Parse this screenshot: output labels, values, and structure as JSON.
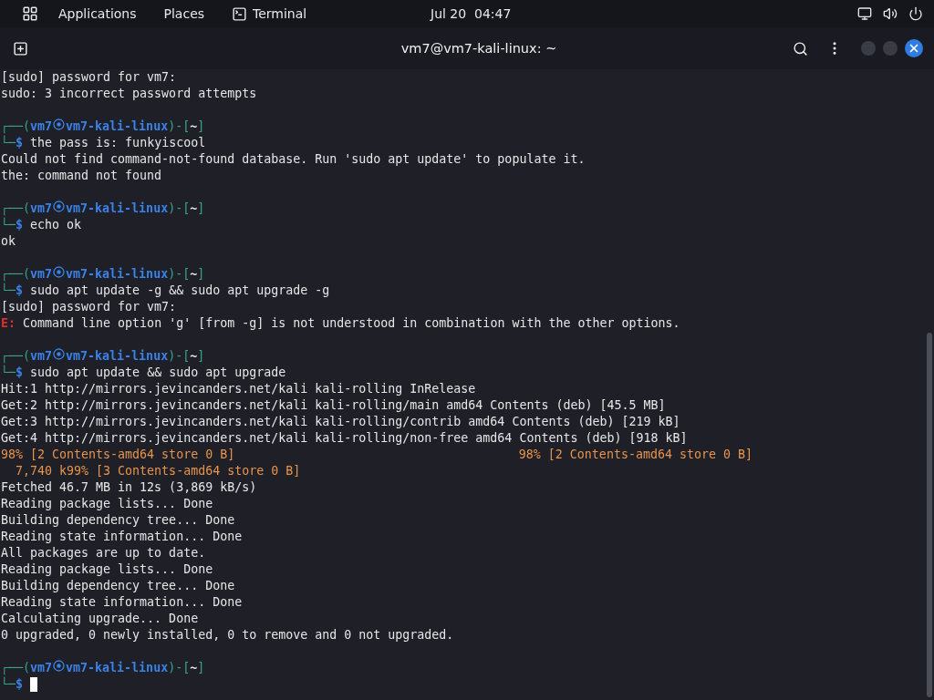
{
  "top_bar": {
    "menus": [
      {
        "label": "Applications",
        "kind": "menu"
      },
      {
        "label": "Places",
        "kind": "menu"
      },
      {
        "label": "Terminal",
        "kind": "app"
      }
    ],
    "clock": "Jul 20  04:47"
  },
  "window": {
    "title": "vm7@vm7-kali-linux: ~"
  },
  "terminal": {
    "lines": [
      {
        "kind": "text",
        "text": "[sudo] password for vm7:"
      },
      {
        "kind": "text",
        "text": "sudo: 3 incorrect password attempts"
      },
      {
        "kind": "blank"
      },
      {
        "kind": "prompt",
        "open": "┌──(",
        "user": "vm7",
        "host": "vm7-kali-linux",
        "mid": ")-[",
        "dir": "~",
        "close": "]",
        "corner": "└─",
        "dollar": "$",
        "command": "the pass is: funkyiscool"
      },
      {
        "kind": "text",
        "text": "Could not find command-not-found database. Run 'sudo apt update' to populate it."
      },
      {
        "kind": "text",
        "text": "the: command not found"
      },
      {
        "kind": "blank"
      },
      {
        "kind": "prompt",
        "open": "┌──(",
        "user": "vm7",
        "host": "vm7-kali-linux",
        "mid": ")-[",
        "dir": "~",
        "close": "]",
        "corner": "└─",
        "dollar": "$",
        "command": "echo ok"
      },
      {
        "kind": "text",
        "text": "ok"
      },
      {
        "kind": "blank"
      },
      {
        "kind": "prompt",
        "open": "┌──(",
        "user": "vm7",
        "host": "vm7-kali-linux",
        "mid": ")-[",
        "dir": "~",
        "close": "]",
        "corner": "└─",
        "dollar": "$",
        "command": "sudo apt update -g && sudo apt upgrade -g"
      },
      {
        "kind": "text",
        "text": "[sudo] password for vm7:"
      },
      {
        "kind": "error",
        "tag": "E:",
        "text": "Command line option 'g' [from -g] is not understood in combination with the other options."
      },
      {
        "kind": "blank"
      },
      {
        "kind": "prompt",
        "open": "┌──(",
        "user": "vm7",
        "host": "vm7-kali-linux",
        "mid": ")-[",
        "dir": "~",
        "close": "]",
        "corner": "└─",
        "dollar": "$",
        "command": "sudo apt update && sudo apt upgrade"
      },
      {
        "kind": "text",
        "text": "Hit:1 http://mirrors.jevincanders.net/kali kali-rolling InRelease"
      },
      {
        "kind": "text",
        "text": "Get:2 http://mirrors.jevincanders.net/kali kali-rolling/main amd64 Contents (deb) [45.5 MB]"
      },
      {
        "kind": "text",
        "text": "Get:3 http://mirrors.jevincanders.net/kali kali-rolling/contrib amd64 Contents (deb) [219 kB]"
      },
      {
        "kind": "text",
        "text": "Get:4 http://mirrors.jevincanders.net/kali kali-rolling/non-free amd64 Contents (deb) [918 kB]"
      },
      {
        "kind": "progress",
        "left": "98% [2 Contents-amd64 store 0 B]",
        "right": "98% [2 Contents-amd64 store 0 B]"
      },
      {
        "kind": "progress",
        "left": "  7,740 k99% [3 Contents-amd64 store 0 B]"
      },
      {
        "kind": "text",
        "text": "Fetched 46.7 MB in 12s (3,869 kB/s)"
      },
      {
        "kind": "text",
        "text": "Reading package lists... Done"
      },
      {
        "kind": "text",
        "text": "Building dependency tree... Done"
      },
      {
        "kind": "text",
        "text": "Reading state information... Done"
      },
      {
        "kind": "text",
        "text": "All packages are up to date."
      },
      {
        "kind": "text",
        "text": "Reading package lists... Done"
      },
      {
        "kind": "text",
        "text": "Building dependency tree... Done"
      },
      {
        "kind": "text",
        "text": "Reading state information... Done"
      },
      {
        "kind": "text",
        "text": "Calculating upgrade... Done"
      },
      {
        "kind": "text",
        "text": "0 upgraded, 0 newly installed, 0 to remove and 0 not upgraded."
      },
      {
        "kind": "blank"
      },
      {
        "kind": "prompt",
        "open": "┌──(",
        "user": "vm7",
        "host": "vm7-kali-linux",
        "mid": ")-[",
        "dir": "~",
        "close": "]",
        "corner": "└─",
        "dollar": "$",
        "cursor": true
      }
    ]
  }
}
